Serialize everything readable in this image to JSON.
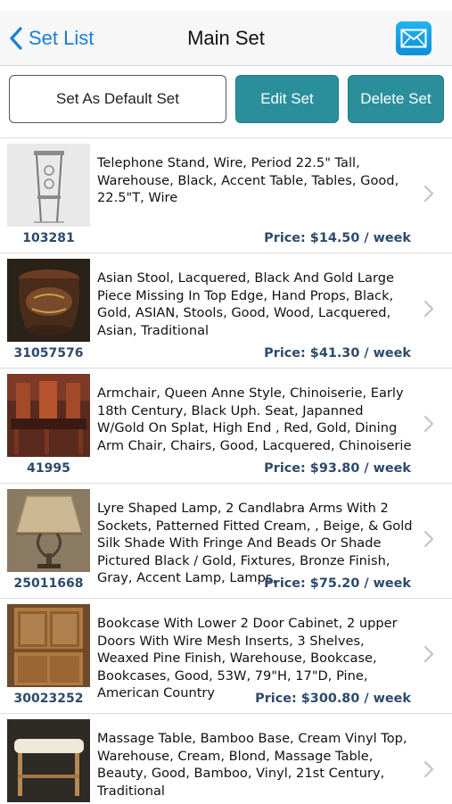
{
  "nav": {
    "back_label": "Set List",
    "title": "Main Set",
    "mail_icon": "envelope-icon"
  },
  "actions": {
    "default_label": "Set As Default Set",
    "edit_label": "Edit Set",
    "delete_label": "Delete Set"
  },
  "colors": {
    "accent_blue": "#1a7fd6",
    "button_teal": "#2a8f9b",
    "id_price_text": "#2d4a6a"
  },
  "items": [
    {
      "id": "103281",
      "description": "Telephone Stand, Wire, Period 22.5\" Tall, Warehouse, Black, Accent Table, Tables, Good, 22.5\"T, Wire",
      "price": "Price: $14.50 / week",
      "image": "telephone-stand-photo"
    },
    {
      "id": "31057576",
      "description": "Asian  Stool, Lacquered, Black And Gold Large Piece Missing In Top Edge, Hand Props, Black, Gold, ASIAN, Stools, Good, Wood, Lacquered, Asian, Traditional",
      "price": "Price: $41.30 / week",
      "image": "asian-stool-photo"
    },
    {
      "id": "41995",
      "description": "Armchair, Queen Anne Style, Chinoiserie, Early 18th Century, Black Uph. Seat, Japanned W/Gold On Splat, High End , Red, Gold, Dining Arm Chair, Chairs, Good, Lacquered, Chinoiserie",
      "price": "Price: $93.80 / week",
      "image": "armchair-photo"
    },
    {
      "id": "25011668",
      "description": "Lyre Shaped Lamp, 2 Candlabra Arms With 2 Sockets, Patterned Fitted Cream, , Beige, & Gold Silk Shade With Fringe And Beads Or  Shade Pictured Black / Gold, Fixtures, Bronze Finish, Gray, Accent Lamp, Lamps,",
      "price": "Price: $75.20 / week",
      "image": "lamp-photo"
    },
    {
      "id": "30023252",
      "description": "Bookcase With Lower 2 Door Cabinet,  2 upper Doors With Wire Mesh Inserts,      3 Shelves, Weaxed Pine Finish, Warehouse, Bookcase, Bookcases, Good, 53W, 79\"H, 17\"D, Pine, American Country",
      "price": "Price: $300.80 / week",
      "image": "bookcase-photo"
    },
    {
      "id": "",
      "description": "Massage Table, Bamboo Base, Cream Vinyl Top, Warehouse, Cream, Blond, Massage Table, Beauty, Good, Bamboo, Vinyl, 21st Century, Traditional",
      "price": "",
      "image": "massage-table-photo"
    }
  ]
}
